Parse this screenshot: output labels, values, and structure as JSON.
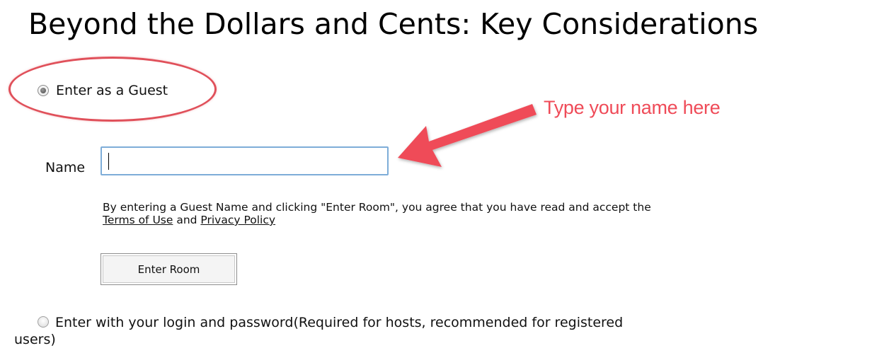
{
  "page": {
    "title": "Beyond the Dollars and Cents: Key Considerations"
  },
  "guest_option": {
    "label": "Enter as a Guest",
    "selected": true
  },
  "annotation": {
    "callout_text": "Type your name here",
    "color": "#ef4b58"
  },
  "name_field": {
    "label": "Name",
    "value": ""
  },
  "terms": {
    "prefix": "By entering a Guest Name and clicking \"Enter Room\", you agree that you have read and accept the ",
    "terms_link": "Terms of Use",
    "conjunction": " and ",
    "privacy_link": "Privacy Policy"
  },
  "enter_room_button": {
    "label": "Enter Room"
  },
  "login_option": {
    "label": "Enter with your login and password(Required for hosts, recommended for registered users)",
    "selected": false
  },
  "colors": {
    "input_border": "#7eadd8",
    "highlight": "#e0505a"
  }
}
